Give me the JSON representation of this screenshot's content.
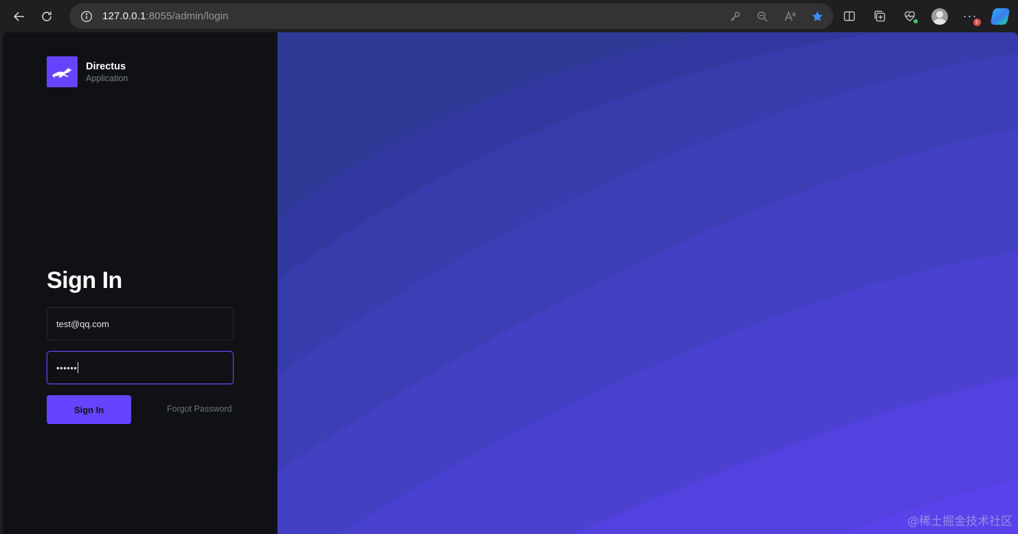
{
  "browser": {
    "url_host": "127.0.0.1",
    "url_path": ":8055/admin/login",
    "notification_count": "1"
  },
  "brand": {
    "name": "Directus",
    "subtitle": "Application",
    "color": "#6644ff"
  },
  "login": {
    "title": "Sign In",
    "email_value": "test@qq.com",
    "password_masked": "••••••",
    "submit_label": "Sign In",
    "forgot_label": "Forgot Password"
  },
  "watermark": "@稀土掘金技术社区",
  "colors": {
    "left_bg": "#0f1115",
    "accent": "#6644ff",
    "wave_dark": "#2d3a96",
    "wave_light": "#5a3ff5"
  }
}
